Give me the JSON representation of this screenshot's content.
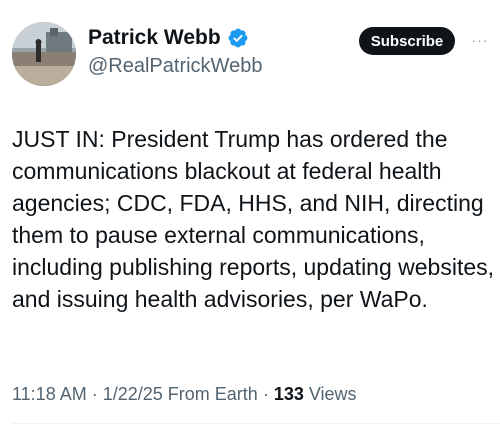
{
  "author": {
    "name": "Patrick Webb",
    "handle": "@RealPatrickWebb",
    "verified": true
  },
  "actions": {
    "subscribe_label": "Subscribe",
    "more_label": "···"
  },
  "tweet": {
    "text": "JUST IN: President Trump has ordered the communications blackout at federal health agencies; CDC, FDA, HHS, and NIH, directing them to pause external communications, including publishing reports, updating websites, and issuing health advisories, per WaPo."
  },
  "meta": {
    "time": "11:18 AM",
    "separator": "·",
    "date": "1/22/25",
    "source": "From Earth",
    "views_count": "133",
    "views_label": "Views"
  },
  "colors": {
    "verified_badge": "#1d9bf0",
    "subscribe_bg": "#0f1419",
    "secondary_text": "#536471"
  }
}
